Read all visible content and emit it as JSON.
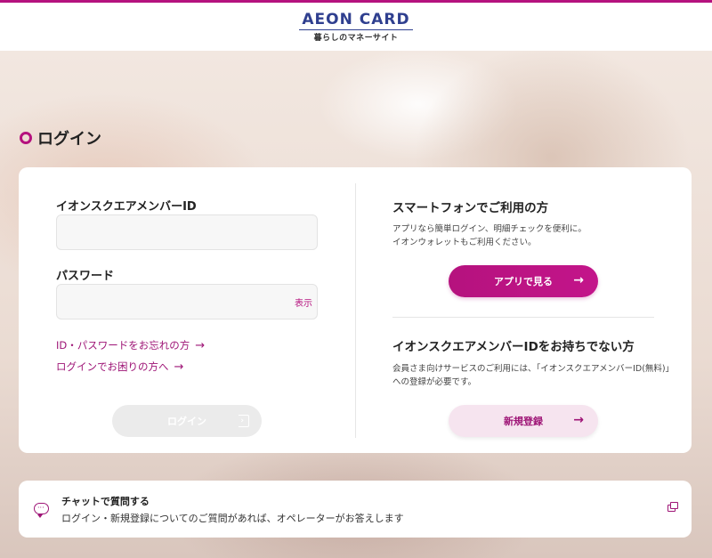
{
  "header": {
    "logo_main": "AEON CARD",
    "logo_sub": "暮らしのマネーサイト"
  },
  "page": {
    "title": "ログイン"
  },
  "login": {
    "id_label": "イオンスクエアメンバーID",
    "id_value": "",
    "password_label": "パスワード",
    "password_value": "",
    "show_label": "表示",
    "forgot_link": "ID・パスワードをお忘れの方",
    "trouble_link": "ログインでお困りの方へ",
    "submit_label": "ログイン"
  },
  "smartphone": {
    "heading": "スマートフォンでご利用の方",
    "desc_line1": "アプリなら簡単ログイン、明細チェックを便利に。",
    "desc_line2": "イオンウォレットもご利用ください。",
    "button_label": "アプリで見る"
  },
  "register": {
    "heading": "イオンスクエアメンバーIDをお持ちでない方",
    "desc_line1": "会員さま向けサービスのご利用には、「イオンスクエアメンバーID(無料)」",
    "desc_line2": "への登録が必要です。",
    "button_label": "新規登録"
  },
  "chat": {
    "title": "チャットで質問する",
    "desc": "ログイン・新規登録についてのご質問があれば、オペレーターがお答えします"
  },
  "colors": {
    "accent": "#b5127e",
    "link": "#9e1476",
    "brand_blue": "#2f3f8f",
    "disabled_button": "#ebebeb",
    "register_button_bg": "#f6e4ef"
  },
  "icons": {
    "link_arrow": "→",
    "button_arrow": "→",
    "login_icon": "login-icon",
    "chat_icon": "chat-bubble-icon",
    "external_icon": "external-window-icon"
  }
}
